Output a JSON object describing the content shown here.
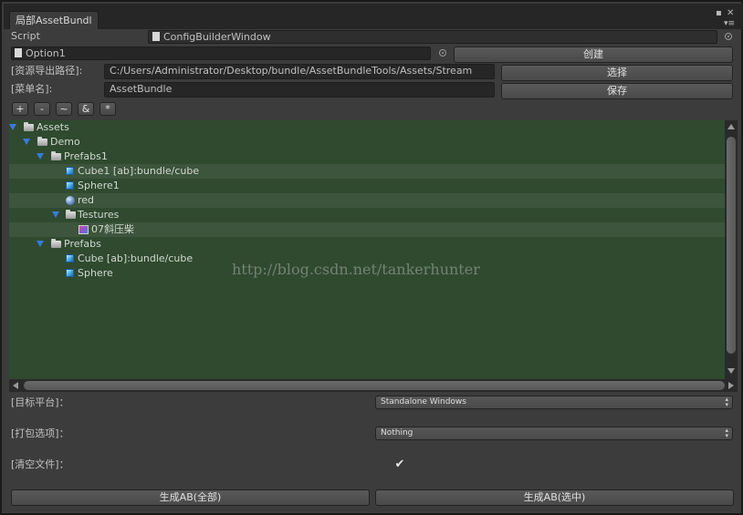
{
  "window": {
    "tab_title": "局部AssetBundl",
    "menu_icon": "list-menu-icon",
    "close_icon": "close-icon"
  },
  "script_row": {
    "label": "Script",
    "value": "ConfigBuilderWindow"
  },
  "option_row": {
    "value": "Option1",
    "create_button": "创建"
  },
  "export_path": {
    "label": "[资源导出路径]:",
    "value": "C:/Users/Administrator/Desktop/bundle/AssetBundleTools/Assets/Stream",
    "select_button": "选择"
  },
  "menu_name": {
    "label": "[菜单名]:",
    "value": "AssetBundle",
    "save_button": "保存"
  },
  "toolbar": {
    "buttons": [
      "+",
      "-",
      "~",
      "&",
      "*"
    ]
  },
  "tree": {
    "items": [
      {
        "label": "Assets",
        "icon": "folder-icon",
        "expanded": true
      },
      {
        "label": "Demo",
        "icon": "folder-icon",
        "expanded": true
      },
      {
        "label": "Prefabs1",
        "icon": "folder-icon",
        "expanded": true
      },
      {
        "label": "Cube1 [ab]:bundle/cube",
        "icon": "cube-icon"
      },
      {
        "label": "Sphere1",
        "icon": "cube-icon"
      },
      {
        "label": "red",
        "icon": "sphere-icon"
      },
      {
        "label": "Testures",
        "icon": "folder-icon",
        "expanded": true
      },
      {
        "label": "07斜压柴",
        "icon": "texture-icon"
      },
      {
        "label": "Prefabs",
        "icon": "folder-icon",
        "expanded": true
      },
      {
        "label": "Cube [ab]:bundle/cube",
        "icon": "cube-icon"
      },
      {
        "label": "Sphere",
        "icon": "cube-icon"
      }
    ]
  },
  "watermark": "http://blog.csdn.net/tankerhunter",
  "settings": {
    "platform_label": "[目标平台]：",
    "platform_value": "Standalone Windows",
    "options_label": "[打包选项]：",
    "options_value": "Nothing",
    "clear_label": "[清空文件]：",
    "clear_checked": true
  },
  "actions": {
    "build_all": "生成AB(全部)",
    "build_selected": "生成AB(选中)"
  },
  "colors": {
    "tree_background": "#2f4a2f",
    "expand_arrow": "#3a7ad8"
  }
}
